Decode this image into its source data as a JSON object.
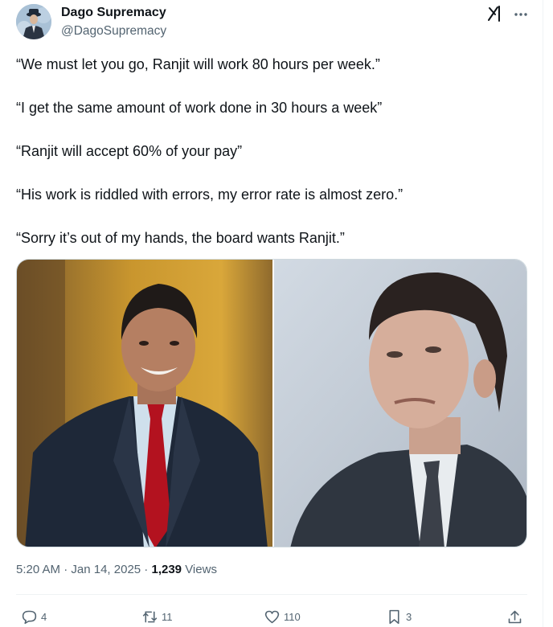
{
  "author": {
    "display_name": "Dago Supremacy",
    "handle": "@DagoSupremacy"
  },
  "tweet": {
    "lines": [
      "“We must let you go, Ranjit will work 80 hours per week.”",
      "“I get the same amount of work done in 30 hours a week”",
      "“Ranjit will accept 60% of your pay”",
      "“His work is riddled with errors, my error rate is almost zero.”",
      "“Sorry it’s out of my hands, the board wants Ranjit.”"
    ]
  },
  "meta": {
    "time": "5:20 AM",
    "separator": " · ",
    "date": "Jan 14, 2025",
    "separator2": " · ",
    "views_count": "1,239",
    "views_label": " Views"
  },
  "actions": {
    "replies": "4",
    "reposts": "11",
    "likes": "110",
    "bookmarks": "3"
  },
  "icons": {
    "header": [
      "grok-icon",
      "more-icon"
    ],
    "actions": [
      "reply-icon",
      "repost-icon",
      "like-icon",
      "bookmark-icon",
      "share-icon"
    ]
  },
  "colors": {
    "text": "#0f1419",
    "secondary": "#536471",
    "border": "#cfd9de"
  }
}
